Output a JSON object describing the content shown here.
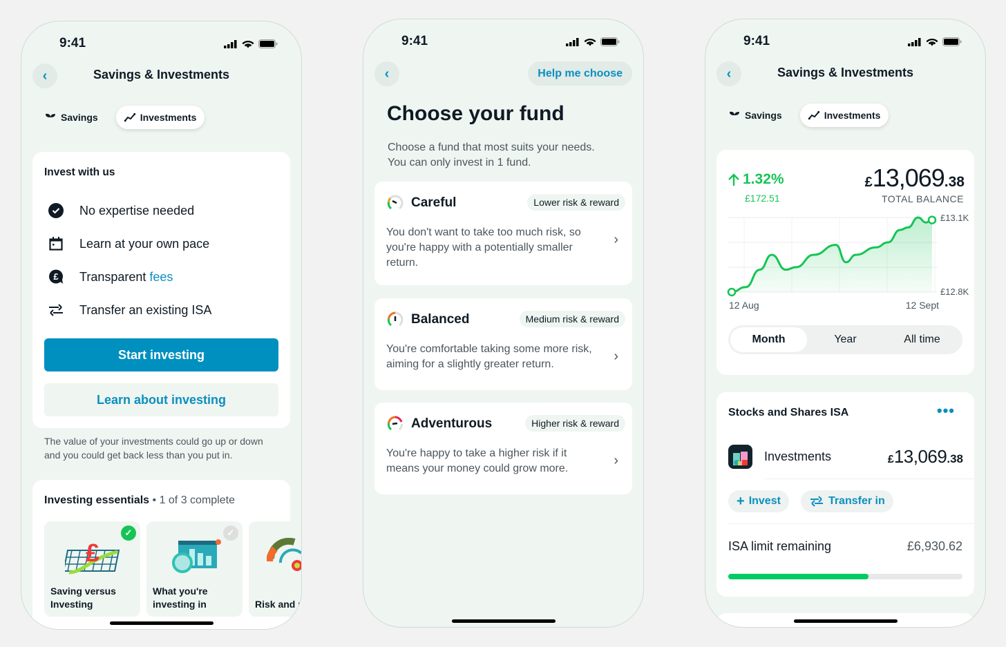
{
  "colors": {
    "accent": "#0090bf",
    "link": "#0b8fbe",
    "positive": "#16c455",
    "screen_bg": "#eff5f1"
  },
  "status_bar": {
    "time": "9:41"
  },
  "screen1": {
    "title": "Savings & Investments",
    "tabs": [
      {
        "label": "Savings",
        "icon": "sprout-icon",
        "active": false
      },
      {
        "label": "Investments",
        "icon": "trend-line-icon",
        "active": true
      }
    ],
    "invest_card": {
      "heading": "Invest with us",
      "features": [
        {
          "icon": "check-circle-icon",
          "text": "No expertise needed"
        },
        {
          "icon": "calendar-icon",
          "text": "Learn at your own pace"
        },
        {
          "icon": "pound-bubble-icon",
          "text": "Transparent ",
          "link": "fees"
        },
        {
          "icon": "transfer-arrows-icon",
          "text": "Transfer an existing ISA"
        }
      ],
      "primary_button": "Start investing",
      "secondary_button": "Learn about investing"
    },
    "disclaimer": "The value of your investments could go up or down and you could get back less than you put in.",
    "essentials": {
      "heading": "Investing essentials",
      "progress": "• 1 of 3 complete",
      "lessons": [
        {
          "label_line1": "Saving versus",
          "label_line2": "Investing",
          "complete": true
        },
        {
          "label_line1": "What you're",
          "label_line2": "investing in",
          "complete": false
        },
        {
          "label_line1": "",
          "label_line2": "Risk and r",
          "complete": false
        }
      ]
    }
  },
  "screen2": {
    "help_button": "Help me choose",
    "title": "Choose your fund",
    "subtitle_line1": "Choose a fund that most suits your needs.",
    "subtitle_line2": "You can only invest in 1 fund.",
    "funds": [
      {
        "name": "Careful",
        "badge": "Lower risk & reward",
        "desc": "You don't want to take too much risk, so you're happy with a potentially smaller return.",
        "risk_level": 1
      },
      {
        "name": "Balanced",
        "badge": "Medium risk & reward",
        "desc": "You're comfortable taking some more risk, aiming for a slightly greater return.",
        "risk_level": 2
      },
      {
        "name": "Adventurous",
        "badge": "Higher risk & reward",
        "desc": "You're happy to take a higher risk if it means your money could grow more.",
        "risk_level": 3
      }
    ]
  },
  "screen3": {
    "title": "Savings & Investments",
    "tabs": [
      {
        "label": "Savings",
        "active": false
      },
      {
        "label": "Investments",
        "active": true
      }
    ],
    "change_pct": "1.32%",
    "change_amount": "£172.51",
    "balance_currency": "£",
    "balance_main": "13,069",
    "balance_pence": ".38",
    "balance_label": "TOTAL BALANCE",
    "periods": [
      "Month",
      "Year",
      "All time"
    ],
    "selected_period": "Month",
    "isa": {
      "heading": "Stocks and Shares ISA",
      "account_name": "Investments",
      "account_currency": "£",
      "account_main": "13,069",
      "account_pence": ".38",
      "invest_button": "Invest",
      "transfer_button": "Transfer in",
      "limit_label": "ISA limit remaining",
      "limit_value": "£6,930.62",
      "limit_used_fraction": 0.6
    }
  },
  "chart_data": {
    "type": "area",
    "title": "",
    "x_start_label": "12 Aug",
    "x_end_label": "12 Sept",
    "y_tick_labels": [
      "£12.8K",
      "£13.1K"
    ],
    "ylim": [
      12.8,
      13.1
    ],
    "ylabel": "",
    "xlabel": "",
    "grid": true,
    "x": [
      0,
      0.07,
      0.14,
      0.2,
      0.27,
      0.32,
      0.41,
      0.52,
      0.57,
      0.62,
      0.72,
      0.78,
      0.84,
      0.88,
      0.93,
      0.97,
      1.0
    ],
    "values": [
      12.8,
      12.82,
      12.89,
      12.95,
      12.89,
      12.9,
      12.95,
      12.99,
      12.92,
      12.95,
      12.98,
      13.0,
      13.05,
      13.06,
      13.1,
      13.08,
      13.09
    ]
  }
}
